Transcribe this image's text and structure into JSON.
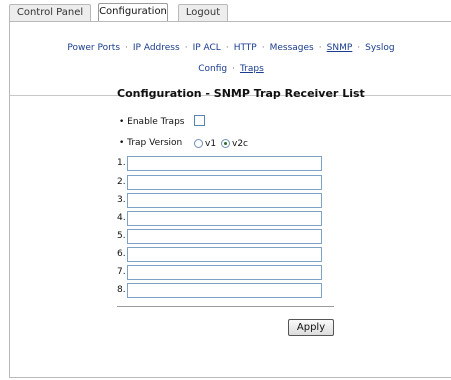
{
  "tabs": [
    {
      "label": "Control Panel",
      "active": false
    },
    {
      "label": "Configuration",
      "active": true
    },
    {
      "label": "Logout",
      "active": false
    }
  ],
  "nav_row1": [
    {
      "label": "Power Ports",
      "current": false
    },
    {
      "label": "IP Address",
      "current": false
    },
    {
      "label": "IP ACL",
      "current": false
    },
    {
      "label": "HTTP",
      "current": false
    },
    {
      "label": "Messages",
      "current": false
    },
    {
      "label": "SNMP",
      "current": true
    },
    {
      "label": "Syslog",
      "current": false
    }
  ],
  "nav_row2": [
    {
      "label": "Config",
      "current": false
    },
    {
      "label": "Traps",
      "current": true
    }
  ],
  "nav_separator": "·",
  "form": {
    "title": "Configuration - SNMP Trap Receiver List",
    "enable_label": "• Enable Traps",
    "enable_checked": false,
    "version_label": "• Trap Version",
    "version_options": [
      "v1",
      "v2c"
    ],
    "version_selected": "v2c",
    "receivers": [
      {
        "num": "1.",
        "value": ""
      },
      {
        "num": "2.",
        "value": ""
      },
      {
        "num": "3.",
        "value": ""
      },
      {
        "num": "4.",
        "value": ""
      },
      {
        "num": "5.",
        "value": ""
      },
      {
        "num": "6.",
        "value": ""
      },
      {
        "num": "7.",
        "value": ""
      },
      {
        "num": "8.",
        "value": ""
      }
    ],
    "apply_label": "Apply"
  },
  "colors": {
    "link": "#1a3d8f",
    "input_border": "#7ea1c8",
    "tab_border": "#b9b9b9"
  }
}
